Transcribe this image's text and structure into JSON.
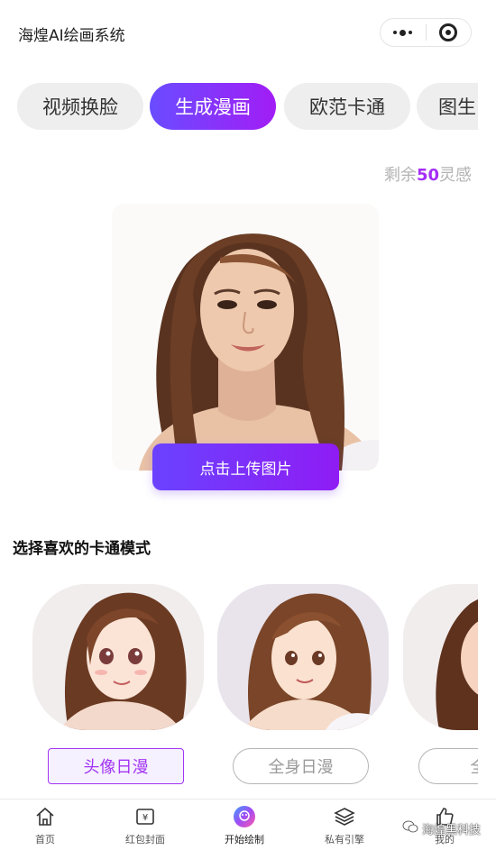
{
  "header": {
    "title": "海煌AI绘画系统",
    "more_icon": "more-dots-icon",
    "close_icon": "target-close-icon"
  },
  "tabs": [
    {
      "label": "视频换脸",
      "active": false
    },
    {
      "label": "生成漫画",
      "active": true
    },
    {
      "label": "欧范卡通",
      "active": false
    },
    {
      "label": "图生",
      "active": false
    }
  ],
  "credits": {
    "prefix": "剩余",
    "count": "50",
    "suffix": "灵感"
  },
  "upload": {
    "button_label": "点击上传图片"
  },
  "styles_section": {
    "title": "选择喜欢的卡通模式",
    "options": [
      {
        "label": "头像日漫",
        "selected": true
      },
      {
        "label": "全身日漫",
        "selected": false
      },
      {
        "label": "全身",
        "selected": false
      }
    ]
  },
  "tabbar": {
    "items": [
      {
        "label": "首页",
        "icon": "home-icon"
      },
      {
        "label": "红包封面",
        "icon": "red-envelope-icon"
      },
      {
        "label": "开始绘制",
        "icon": "palette-icon"
      },
      {
        "label": "私有引擎",
        "icon": "layers-icon"
      },
      {
        "label": "我的",
        "icon": "thumbs-up-icon"
      }
    ]
  },
  "watermark": {
    "text": "海煌黑科技"
  },
  "colors": {
    "accent_start": "#6a4cff",
    "accent_end": "#a21df6",
    "credit_number": "#a42ef6"
  }
}
